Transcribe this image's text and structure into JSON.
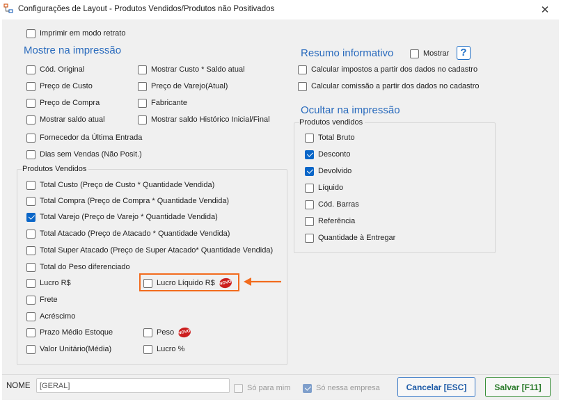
{
  "window": {
    "title": "Configurações de Layout - Produtos Vendidos/Produtos não Positivados",
    "close_glyph": "✕",
    "icon": "sitemap-icon"
  },
  "top": {
    "imprimir_retrato": {
      "label": "Imprimir em modo retrato",
      "checked": false
    }
  },
  "mostre": {
    "title": "Mostre na impressão",
    "col1": [
      {
        "label": "Cód. Original",
        "checked": false
      },
      {
        "label": "Preço de Custo",
        "checked": false
      },
      {
        "label": "Preço de Compra",
        "checked": false
      },
      {
        "label": "Mostrar saldo atual",
        "checked": false
      }
    ],
    "col2": [
      {
        "label": "Mostrar Custo * Saldo atual",
        "checked": false
      },
      {
        "label": "Preço de Varejo(Atual)",
        "checked": false
      },
      {
        "label": "Fabricante",
        "checked": false
      },
      {
        "label": "Mostrar saldo Histórico Inicial/Final",
        "checked": false
      }
    ],
    "full": [
      {
        "label": "Fornecedor da Última Entrada",
        "checked": false
      },
      {
        "label": "Dias sem Vendas (Não Posit.)",
        "checked": false
      }
    ]
  },
  "produtos_vendidos": {
    "title": "Produtos Vendidos",
    "full": [
      {
        "label": "Total Custo (Preço de Custo * Quantidade Vendida)",
        "checked": false
      },
      {
        "label": "Total Compra (Preço de Compra * Quantidade Vendida)",
        "checked": false
      },
      {
        "label": "Total Varejo (Preço de Varejo * Quantidade Vendida)",
        "checked": true
      },
      {
        "label": "Total Atacado (Preço de Atacado * Quantidade Vendida)",
        "checked": false
      },
      {
        "label": "Total Super Atacado (Preço de Super Atacado* Quantidade Vendida)",
        "checked": false
      },
      {
        "label": "Total do Peso diferenciado",
        "checked": false
      }
    ],
    "lucro_rs": {
      "label": "Lucro R$",
      "checked": false
    },
    "lucro_liquido": {
      "label": "Lucro Líquido R$",
      "checked": false,
      "badge": "NOVO"
    },
    "frete": {
      "label": "Frete",
      "checked": false
    },
    "acrescimo": {
      "label": "Acréscimo",
      "checked": false
    },
    "prazo_medio": {
      "label": "Prazo Médio Estoque",
      "checked": false
    },
    "peso": {
      "label": "Peso",
      "checked": false,
      "badge": "NOVO"
    },
    "valor_unitario": {
      "label": "Valor Unitário(Média)",
      "checked": false
    },
    "lucro_pct": {
      "label": "Lucro %",
      "checked": false
    }
  },
  "resumo": {
    "title": "Resumo informativo",
    "mostrar": {
      "label": "Mostrar",
      "checked": false
    },
    "help_glyph": "?",
    "items": [
      {
        "label": "Calcular impostos a partir dos dados no cadastro",
        "checked": false
      },
      {
        "label": "Calcular comissão a partir dos dados no cadastro",
        "checked": false
      }
    ]
  },
  "ocultar": {
    "title": "Ocultar na impressão",
    "group_title": "Produtos vendidos",
    "items": [
      {
        "label": "Total Bruto",
        "checked": false
      },
      {
        "label": "Desconto",
        "checked": true
      },
      {
        "label": "Devolvido",
        "checked": true
      },
      {
        "label": "Líquido",
        "checked": false
      },
      {
        "label": "Cód. Barras",
        "checked": false
      },
      {
        "label": "Referência",
        "checked": false
      },
      {
        "label": "Quantidade à Entregar",
        "checked": false
      }
    ]
  },
  "footer": {
    "nome_label": "NOME",
    "nome_value": "[GERAL]",
    "so_para_mim": {
      "label": "Só para mim",
      "checked": false
    },
    "so_nessa_empresa": {
      "label": "Só nessa empresa",
      "checked": true
    },
    "cancel_label": "Cancelar [ESC]",
    "save_label": "Salvar [F11]"
  },
  "colors": {
    "accent": "#2a6bbd",
    "highlight": "#f26b1d",
    "check": "#0a66c8",
    "save": "#2a7a2a"
  }
}
